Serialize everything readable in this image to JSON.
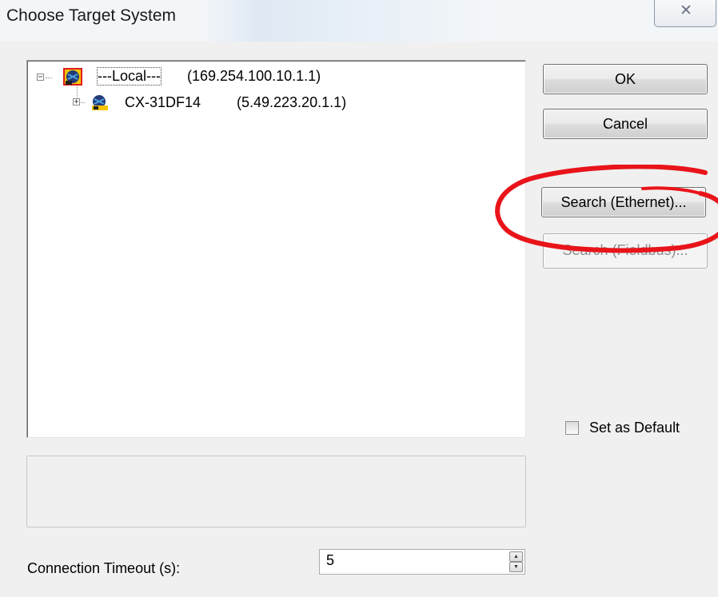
{
  "window": {
    "title": "Choose Target System",
    "close_glyph": "✕"
  },
  "tree": {
    "nodes": [
      {
        "expander": "−",
        "label": "---Local---",
        "address": "(169.254.100.10.1.1)",
        "icon": "network-computer-icon",
        "selected": true
      },
      {
        "expander": "+",
        "label": "CX-31DF14",
        "address": "(5.49.223.20.1.1)",
        "icon": "network-device-icon",
        "selected": false
      }
    ]
  },
  "buttons": {
    "ok": "OK",
    "cancel": "Cancel",
    "search_ethernet": "Search (Ethernet)...",
    "search_fieldbus": "Search (Fieldbus)..."
  },
  "set_as_default": {
    "label": "Set as Default",
    "checked": false
  },
  "connection_timeout": {
    "label": "Connection Timeout (s):",
    "value": "5"
  },
  "annotation": {
    "color": "#e8141a",
    "shape": "hand-drawn-ellipse"
  },
  "colors": {
    "dialog_bg": "#f0f0f0",
    "tree_bg": "#ffffff"
  }
}
